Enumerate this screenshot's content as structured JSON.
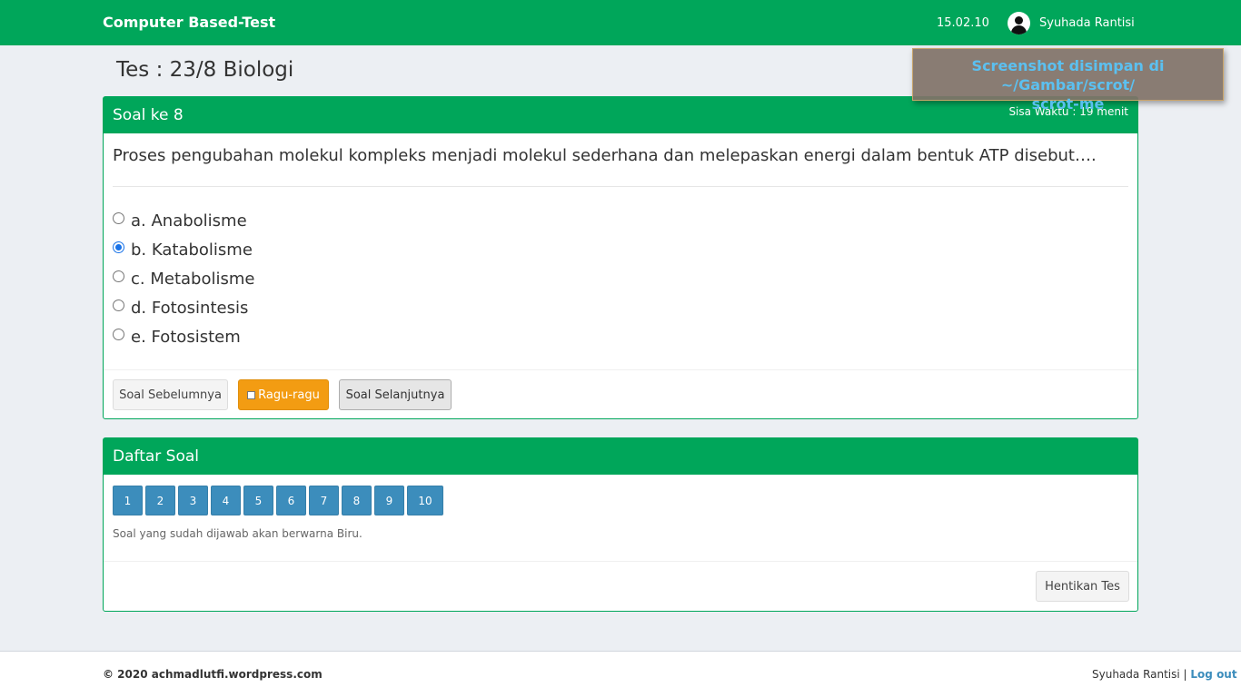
{
  "header": {
    "brand": "Computer Based-Test",
    "time": "15.02.10",
    "user": "Syuhada Rantisi"
  },
  "page": {
    "title": "Tes : 23/8 Biologi"
  },
  "toast": {
    "line1": "Screenshot disimpan di ~/Gambar/scrot/",
    "line2": "scrot-me"
  },
  "question_panel": {
    "title": "Soal ke 8",
    "timer": "Sisa Waktu : 19 menit",
    "question": "Proses pengubahan molekul kompleks menjadi molekul sederhana dan melepaskan energi dalam bentuk ATP disebut….",
    "options": [
      {
        "label": "a. Anabolisme",
        "selected": false
      },
      {
        "label": "b. Katabolisme",
        "selected": true
      },
      {
        "label": "c. Metabolisme",
        "selected": false
      },
      {
        "label": "d. Fotosintesis",
        "selected": false
      },
      {
        "label": "e. Fotosistem",
        "selected": false
      }
    ],
    "buttons": {
      "prev": "Soal Sebelumnya",
      "doubt": "Ragu-ragu",
      "next": "Soal Selanjutnya"
    }
  },
  "list_panel": {
    "title": "Daftar Soal",
    "numbers": [
      "1",
      "2",
      "3",
      "4",
      "5",
      "6",
      "7",
      "8",
      "9",
      "10"
    ],
    "hint": "Soal yang sudah dijawab akan berwarna Biru.",
    "stop_button": "Hentikan Tes"
  },
  "footer": {
    "copyright": "© 2020 achmadlutfi.wordpress.com",
    "user": "Syuhada Rantisi",
    "separator": " | ",
    "logout": "Log out"
  },
  "colors": {
    "primary": "#00a65a",
    "answered": "#3c8dbc",
    "warning": "#f39c12"
  }
}
